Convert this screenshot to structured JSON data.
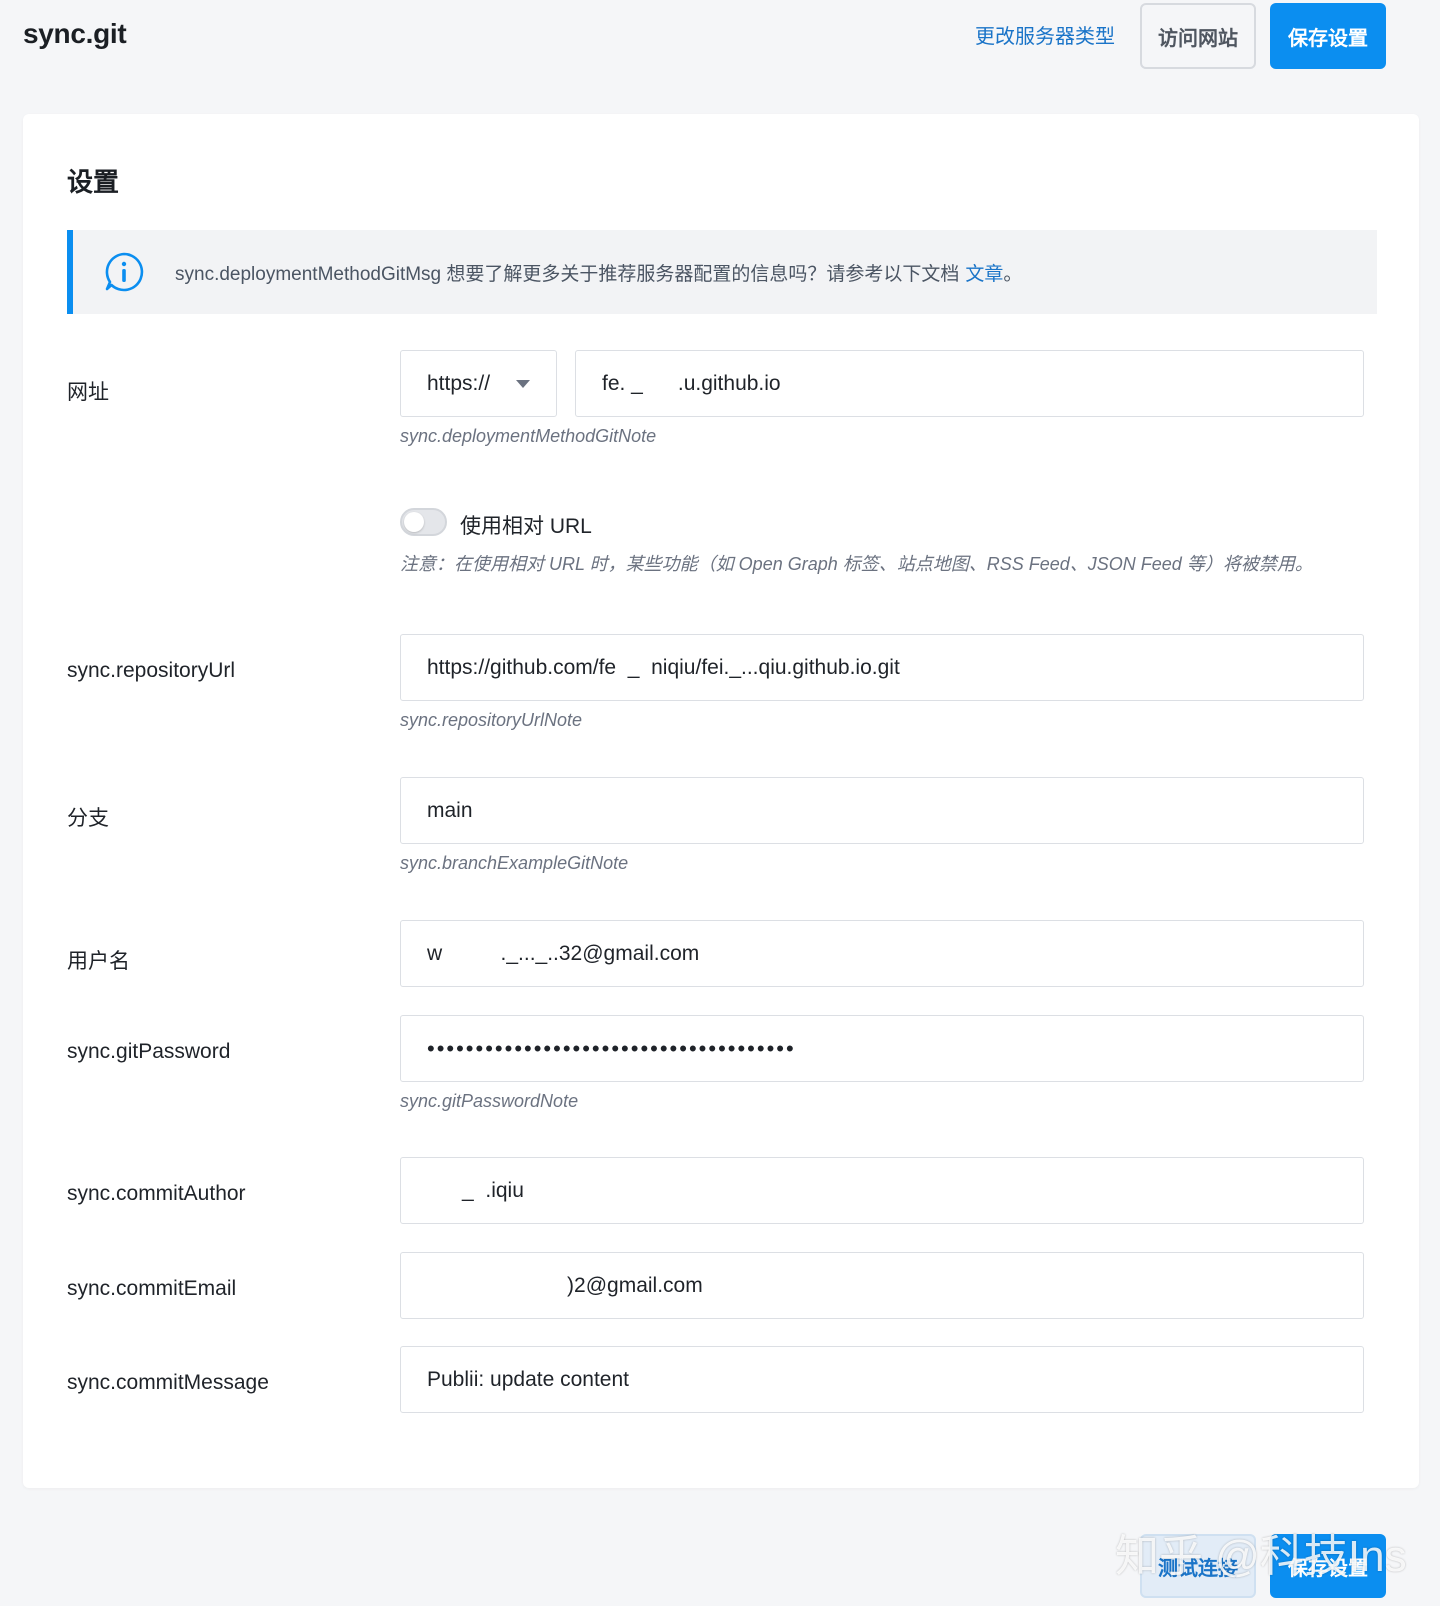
{
  "header": {
    "title": "sync.git",
    "change_server_type": "更改服务器类型",
    "visit_site": "访问网站",
    "save_settings": "保存设置"
  },
  "card": {
    "title": "设置",
    "notice": {
      "text": "sync.deploymentMethodGitMsg 想要了解更多关于推荐服务器配置的信息吗？请参考以下文档",
      "link": "文章",
      "suffix": "。"
    }
  },
  "form": {
    "url": {
      "label": "网址",
      "protocol": "https://",
      "domain": "fe. _      .u.github.io",
      "note": "sync.deploymentMethodGitNote"
    },
    "relative_url": {
      "label": "使用相对 URL",
      "enabled": false,
      "note": "注意：在使用相对 URL 时，某些功能（如 Open Graph 标签、站点地图、RSS Feed、JSON Feed 等）将被禁用。"
    },
    "repository_url": {
      "label": "sync.repositoryUrl",
      "value": "https://github.com/fe  _  niqiu/fei._...qiu.github.io.git",
      "note": "sync.repositoryUrlNote"
    },
    "branch": {
      "label": "分支",
      "value": "main",
      "note": "sync.branchExampleGitNote"
    },
    "username": {
      "label": "用户名",
      "value": "w          ._..._..32@gmail.com"
    },
    "git_password": {
      "label": "sync.gitPassword",
      "value": "••••••••••••••••••••••••••••••••••••••",
      "note": "sync.gitPasswordNote"
    },
    "commit_author": {
      "label": "sync.commitAuthor",
      "value": "      _  .iqiu"
    },
    "commit_email": {
      "label": "sync.commitEmail",
      "value": "                        )2@gmail.com"
    },
    "commit_message": {
      "label": "sync.commitMessage",
      "value": "Publii: update content"
    }
  },
  "footer": {
    "test_connection": "测试连接",
    "save_settings": "保存设置"
  },
  "watermark": "知乎 @科技Ins",
  "colors": {
    "accent": "#0b8ef0",
    "link": "#1a74c8",
    "background": "#f5f6f8"
  }
}
